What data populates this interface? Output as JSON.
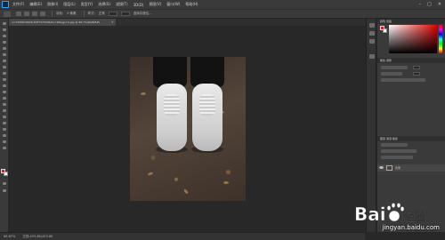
{
  "menubar": {
    "items": [
      "文件(F)",
      "编辑(E)",
      "图像(I)",
      "图层(L)",
      "类型(Y)",
      "选择(S)",
      "滤镜(T)",
      "3D(D)",
      "视图(V)",
      "窗口(W)",
      "帮助(H)"
    ],
    "window_controls": [
      "–",
      "□",
      "✕"
    ]
  },
  "optionsbar": {
    "mode_label": "羽化:",
    "feather_value": "0 像素",
    "style_label": "样式:",
    "style_value": "正常",
    "refine_label": "选择并遮住..."
  },
  "document_tab": {
    "title": "u=1556870928,308757093&fm=26&gp=0.jpg @ 66.7%(RGB/8#)",
    "close_symbol": "×"
  },
  "panels": {
    "color_tab": "颜色 色板",
    "properties_tab": "属性 调整",
    "layers_tab": "图层 通道 路径",
    "layer_name": "背景"
  },
  "statusbar": {
    "zoom": "66.67%",
    "doc_info": "文档:453.8K/453.8K"
  },
  "watermark": {
    "brand": "Bai度经验",
    "url": "jingyan.baidu.com"
  },
  "colors": {
    "foreground": "#e01d1d",
    "background": "#ffffff",
    "ui_dark": "#282828",
    "ui_panel": "#3a3a3a"
  }
}
